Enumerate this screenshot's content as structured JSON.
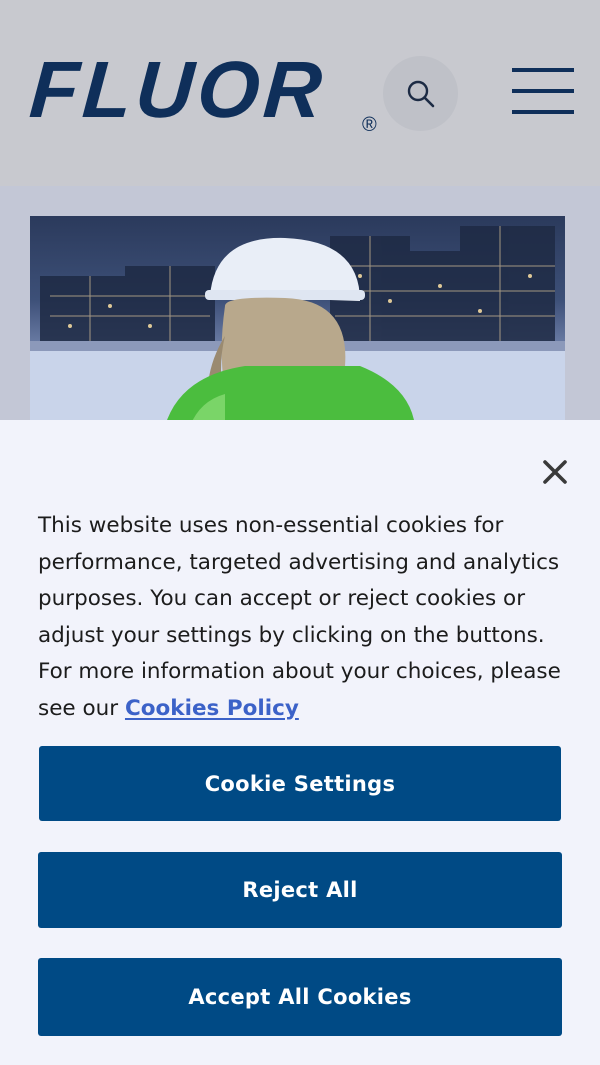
{
  "header": {
    "logo_text": "FLUOR",
    "logo_mark": "®",
    "search_icon": "search-icon",
    "menu_icon": "hamburger-menu-icon"
  },
  "hero": {
    "image": "worker-in-hard-hat-at-industrial-plant"
  },
  "cookie_banner": {
    "close_icon": "close-icon",
    "message": "This website uses non-essential cookies for performance, targeted advertising and analytics purposes. You can accept or reject cookies or adjust your settings by clicking on the buttons. For more information about your choices, please see our",
    "policy_link": "Cookies Policy",
    "settings_label": "Cookie Settings",
    "reject_label": "Reject All",
    "accept_label": "Accept All Cookies"
  },
  "colors": {
    "brand_navy": "#0f2f5a",
    "button_blue": "#004a85",
    "link_blue": "#3c62c8",
    "panel_bg": "#f2f3fb"
  }
}
